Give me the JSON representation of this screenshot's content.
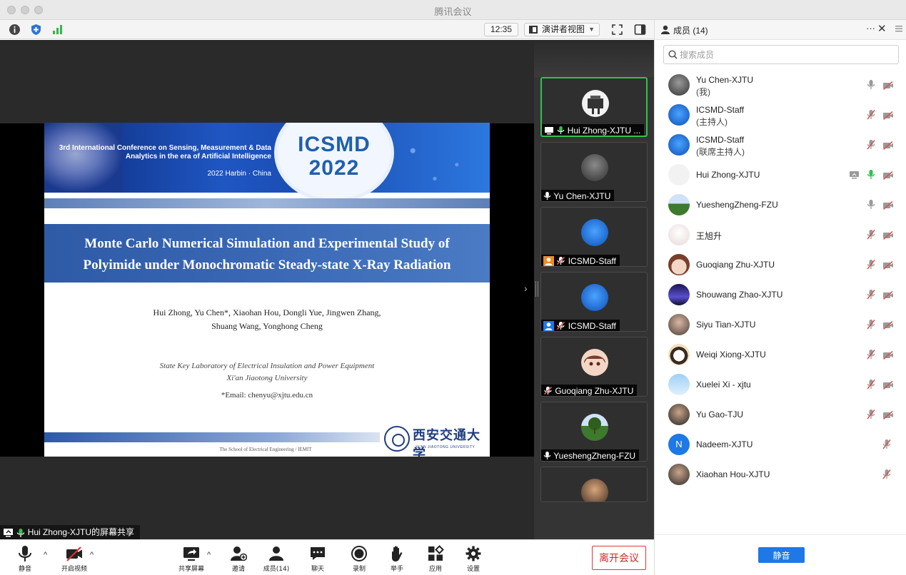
{
  "app": {
    "title": "腾讯会议"
  },
  "toolbar": {
    "time": "12:35",
    "view_mode": "演讲者视图"
  },
  "slide": {
    "conference_line1": "3rd International Conference on Sensing, Measurement & Data",
    "conference_line2": "Analytics in the era of Artificial Intelligence",
    "conference_place": "2022 Harbin · China",
    "logo_line1": "ICSMD",
    "logo_line2": "2022",
    "title_line1": "Monte Carlo Numerical Simulation and Experimental Study of",
    "title_line2": "Polyimide under Monochromatic Steady-state X-Ray Radiation",
    "authors_line1": "Hui Zhong, Yu Chen*, Xiaohan Hou, Dongli Yue, Jingwen Zhang,",
    "authors_line2": "Shuang Wang, Yonghong Cheng",
    "lab_line1": "State Key Laboratory of Electrical Insulation and Power Equipment",
    "lab_line2": "Xi'an Jiaotong University",
    "email": "*Email: chenyu@xjtu.edu.cn",
    "footer": "The School of Electrical Engineering / IEMIT",
    "university_cn": "西安交通大学",
    "university_en": "XI'AN JIAOTONG UNIVERSITY"
  },
  "share_label": "Hui Zhong-XJTU的屏幕共享",
  "thumbnails": [
    {
      "name": "Hui Zhong-XJTU ..."
    },
    {
      "name": "Yu Chen-XJTU"
    },
    {
      "name": "ICSMD-Staff"
    },
    {
      "name": "ICSMD-Staff"
    },
    {
      "name": "Guoqiang Zhu-XJTU"
    },
    {
      "name": "YueshengZheng-FZU"
    }
  ],
  "members_panel": {
    "title": "成员 (14)",
    "search_placeholder": "搜索成员",
    "mute_all": "静音",
    "members": [
      {
        "name": "Yu Chen-XJTU",
        "role": "(我)"
      },
      {
        "name": "ICSMD-Staff",
        "role": "(主持人)"
      },
      {
        "name": "ICSMD-Staff",
        "role": "(联席主持人)"
      },
      {
        "name": "Hui Zhong-XJTU"
      },
      {
        "name": "YueshengZheng-FZU"
      },
      {
        "name": "王旭升"
      },
      {
        "name": "Guoqiang Zhu-XJTU"
      },
      {
        "name": "Shouwang Zhao-XJTU"
      },
      {
        "name": "Siyu Tian-XJTU"
      },
      {
        "name": "Weiqi Xiong-XJTU"
      },
      {
        "name": "Xuelei Xi - xjtu"
      },
      {
        "name": "Yu Gao-TJU"
      },
      {
        "name": "Nadeem-XJTU",
        "initial": "N"
      },
      {
        "name": "Xiaohan Hou-XJTU"
      }
    ]
  },
  "bottombar": {
    "mute": "静音",
    "video": "开启视频",
    "share": "共享屏幕",
    "invite": "邀请",
    "members": "成员(14)",
    "chat": "聊天",
    "record": "录制",
    "raise_hand": "举手",
    "apps": "应用",
    "settings": "设置",
    "leave": "离开会议"
  },
  "colors": {
    "accent": "#1e78e6",
    "speaking": "#2fc24f",
    "leave": "#d02a2a",
    "muted": "#d9534f"
  }
}
